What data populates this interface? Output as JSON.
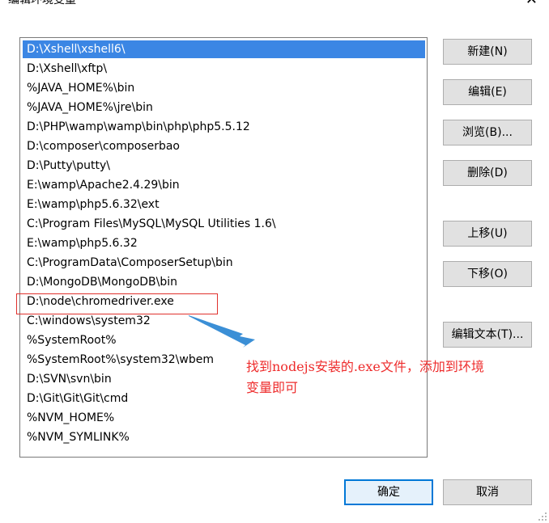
{
  "window": {
    "title": "编辑环境变量",
    "close_glyph": "✕"
  },
  "path_list": {
    "items": [
      "D:\\Xshell\\xshell6\\",
      "D:\\Xshell\\xftp\\",
      "%JAVA_HOME%\\bin",
      "%JAVA_HOME%\\jre\\bin",
      "D:\\PHP\\wamp\\wamp\\bin\\php\\php5.5.12",
      "D:\\composer\\composerbao",
      "D:\\Putty\\putty\\",
      "E:\\wamp\\Apache2.4.29\\bin",
      "E:\\wamp\\php5.6.32\\ext",
      "C:\\Program Files\\MySQL\\MySQL Utilities 1.6\\",
      "E:\\wamp\\php5.6.32",
      "C:\\ProgramData\\ComposerSetup\\bin",
      "D:\\MongoDB\\MongoDB\\bin",
      "D:\\node\\chromedriver.exe",
      "C:\\windows\\system32",
      "%SystemRoot%",
      "%SystemRoot%\\system32\\wbem",
      "D:\\SVN\\svn\\bin",
      "D:\\Git\\Git\\Git\\cmd",
      "%NVM_HOME%",
      "%NVM_SYMLINK%"
    ],
    "selected_index": 0
  },
  "buttons": {
    "new": "新建(N)",
    "edit": "编辑(E)",
    "browse": "浏览(B)...",
    "delete": "删除(D)",
    "move_up": "上移(U)",
    "move_down": "下移(O)",
    "edit_text": "编辑文本(T)...",
    "ok": "确定",
    "cancel": "取消"
  },
  "annotation": {
    "line1": "找到nodejs安装的.exe文件，添加到环境",
    "line2": "变量即可",
    "color": "#ee2c2c"
  },
  "colors": {
    "selection": "#3b86e4",
    "highlight_border": "#e0312d",
    "arrow": "#3b8fd6"
  }
}
